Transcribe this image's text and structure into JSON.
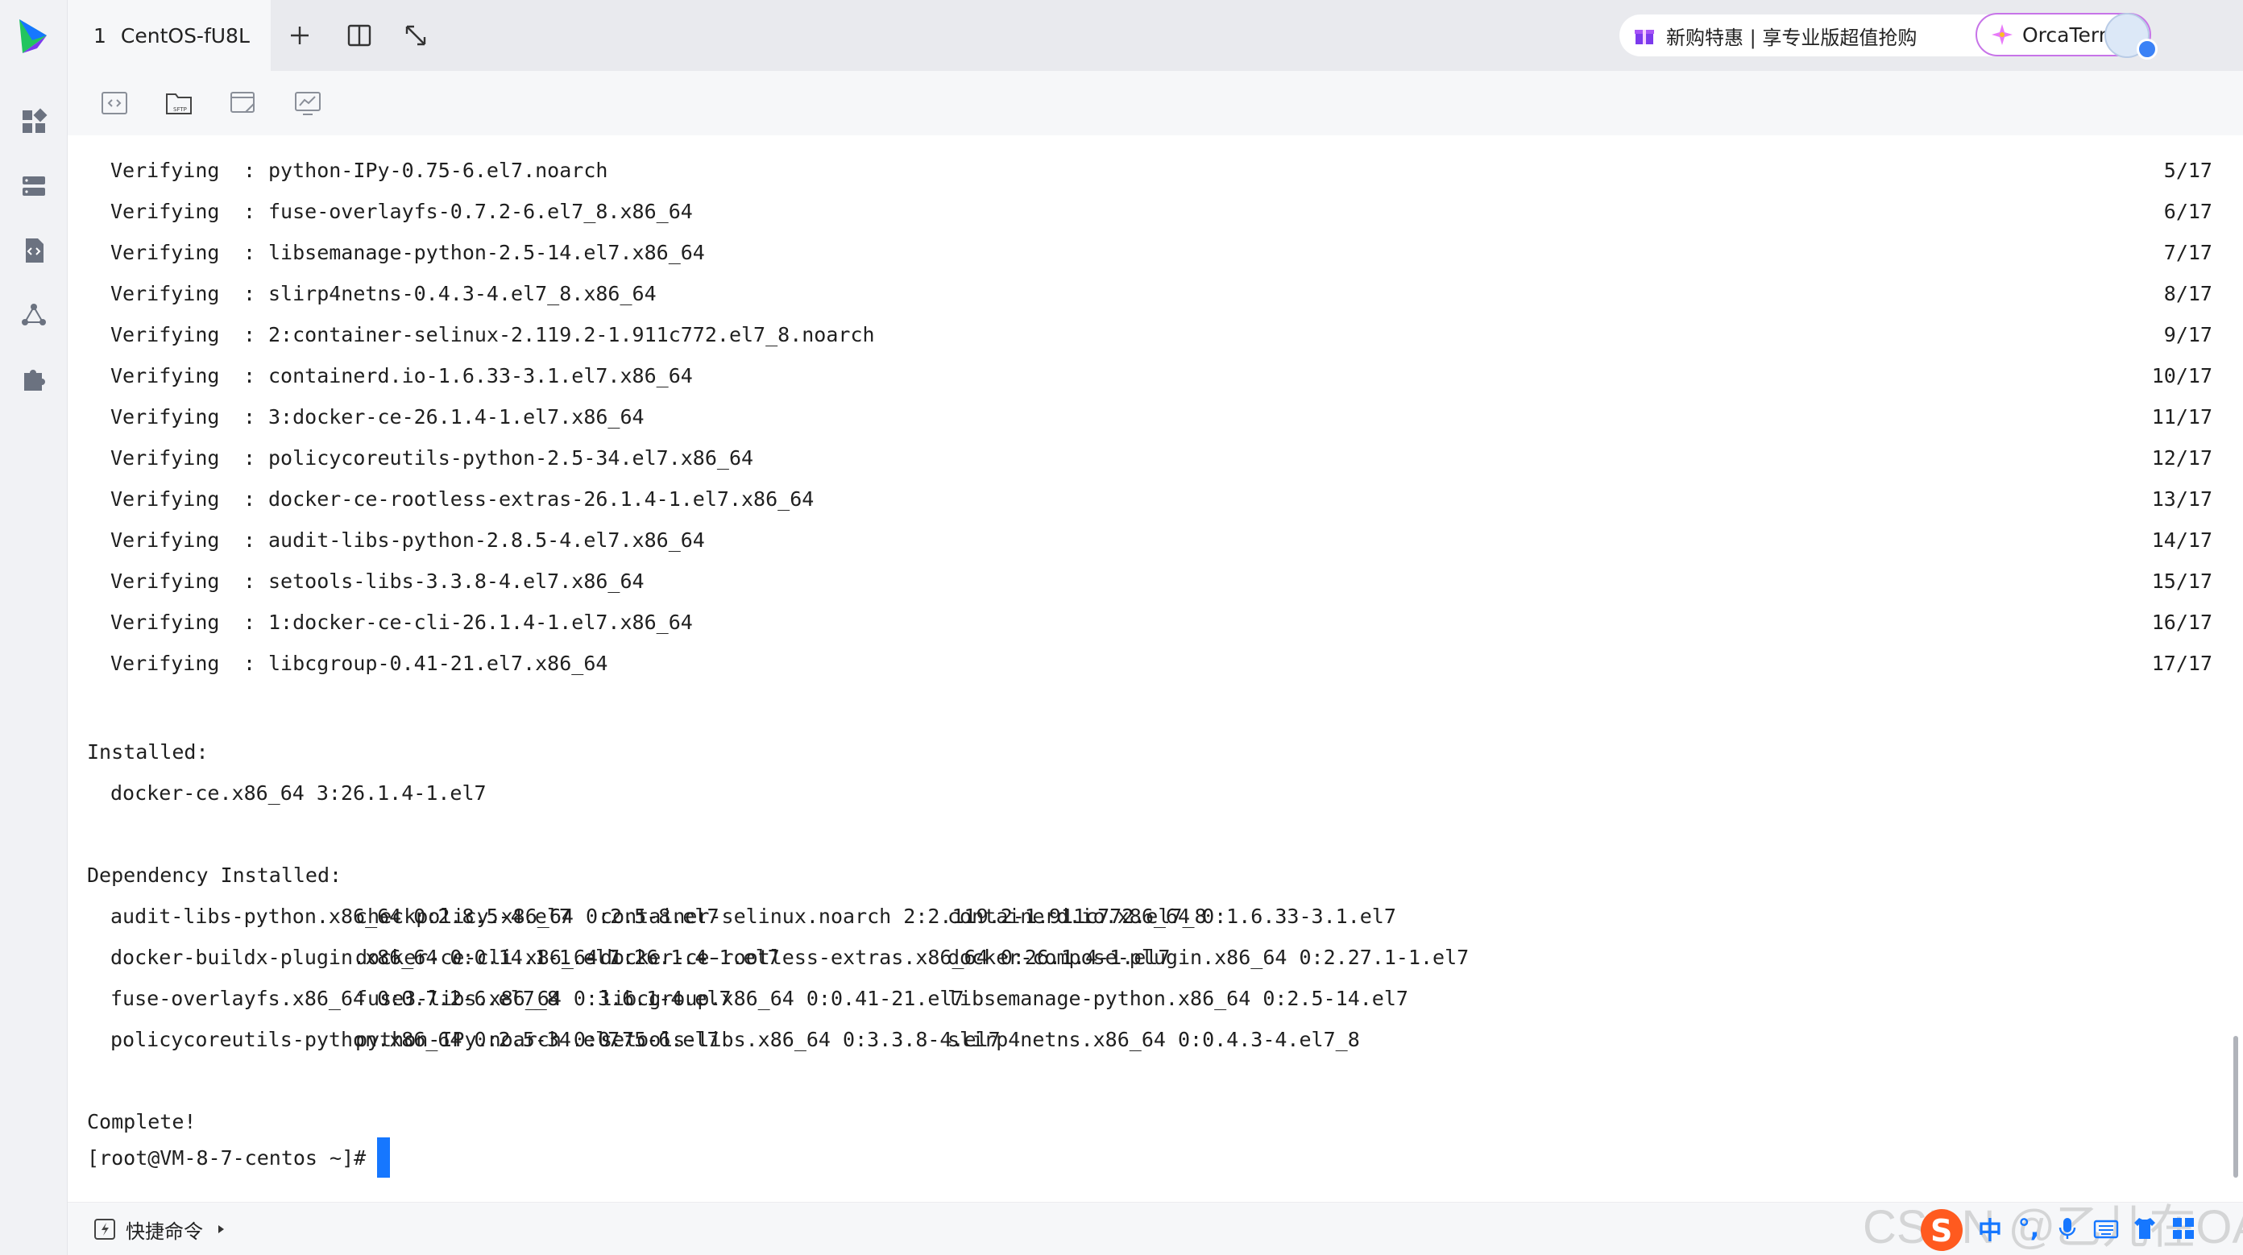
{
  "tab": {
    "number": "1",
    "title": "CentOS-fU8L"
  },
  "promo": {
    "label": "新购特惠 | 享专业版超值抢购"
  },
  "orca": {
    "label": "OrcaTerm AI"
  },
  "verifying": [
    {
      "label": "Verifying",
      "pkg": "python-IPy-0.75-6.el7.noarch",
      "count": "5/17"
    },
    {
      "label": "Verifying",
      "pkg": "fuse-overlayfs-0.7.2-6.el7_8.x86_64",
      "count": "6/17"
    },
    {
      "label": "Verifying",
      "pkg": "libsemanage-python-2.5-14.el7.x86_64",
      "count": "7/17"
    },
    {
      "label": "Verifying",
      "pkg": "slirp4netns-0.4.3-4.el7_8.x86_64",
      "count": "8/17"
    },
    {
      "label": "Verifying",
      "pkg": "2:container-selinux-2.119.2-1.911c772.el7_8.noarch",
      "count": "9/17"
    },
    {
      "label": "Verifying",
      "pkg": "containerd.io-1.6.33-3.1.el7.x86_64",
      "count": "10/17"
    },
    {
      "label": "Verifying",
      "pkg": "3:docker-ce-26.1.4-1.el7.x86_64",
      "count": "11/17"
    },
    {
      "label": "Verifying",
      "pkg": "policycoreutils-python-2.5-34.el7.x86_64",
      "count": "12/17"
    },
    {
      "label": "Verifying",
      "pkg": "docker-ce-rootless-extras-26.1.4-1.el7.x86_64",
      "count": "13/17"
    },
    {
      "label": "Verifying",
      "pkg": "audit-libs-python-2.8.5-4.el7.x86_64",
      "count": "14/17"
    },
    {
      "label": "Verifying",
      "pkg": "setools-libs-3.3.8-4.el7.x86_64",
      "count": "15/17"
    },
    {
      "label": "Verifying",
      "pkg": "1:docker-ce-cli-26.1.4-1.el7.x86_64",
      "count": "16/17"
    },
    {
      "label": "Verifying",
      "pkg": "libcgroup-0.41-21.el7.x86_64",
      "count": "17/17"
    }
  ],
  "colon": ":",
  "installed": {
    "heading": "Installed:",
    "pkg": "docker-ce.x86_64 3:26.1.4-1.el7"
  },
  "dependency": {
    "heading": "Dependency Installed:",
    "rows": [
      [
        "audit-libs-python.x86_64 0:2.8.5-4.el7",
        "checkpolicy.x86_64 0:2.5-8.el7",
        "container-selinux.noarch 2:2.119.2-1.911c772.el7_8",
        "containerd.io.x86_64 0:1.6.33-3.1.el7"
      ],
      [
        "docker-buildx-plugin.x86_64 0:0.14.1-1.el7",
        "docker-ce-cli.x86_64 1:26.1.4-1.el7",
        "docker-ce-rootless-extras.x86_64 0:26.1.4-1.el7",
        "docker-compose-plugin.x86_64 0:2.27.1-1.el7"
      ],
      [
        "fuse-overlayfs.x86_64 0:0.7.2-6.el7_8",
        "fuse3-libs.x86_64 0:3.6.1-4.el7",
        "libcgroup.x86_64 0:0.41-21.el7",
        "libsemanage-python.x86_64 0:2.5-14.el7"
      ],
      [
        "policycoreutils-python.x86_64 0:2.5-34.el7",
        "python-IPy.noarch 0:0.75-6.el7",
        "setools-libs.x86_64 0:3.3.8-4.el7",
        "slirp4netns.x86_64 0:0.4.3-4.el7_8"
      ]
    ]
  },
  "complete": "Complete!",
  "prompt": "[root@VM-8-7-centos ~]#",
  "bottom": {
    "shortcut_label": "快捷命令"
  },
  "watermark": "CSDN @乙儿在OAO",
  "ime": {
    "mode": "中",
    "punct": "°,"
  },
  "colors": {
    "accent": "#1677ff",
    "orca_border": "#c774e8",
    "sidebar_bg": "#f1f2f5"
  }
}
